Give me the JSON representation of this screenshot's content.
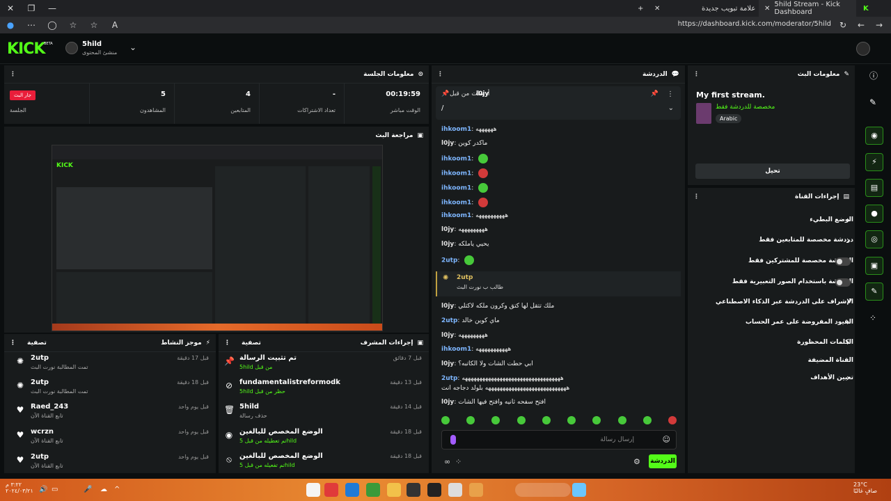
{
  "browser": {
    "tabs": [
      {
        "label": "علامة تبويب جديدة"
      },
      {
        "label": "5hild Stream - Kick Dashboard"
      }
    ],
    "url": "https://dashboard.kick.com/moderator/5hild"
  },
  "topnav": {
    "logo": "KICK",
    "beta": "BETA",
    "channel_name": "5hild",
    "channel_sub": "منشئ المحتوى"
  },
  "session": {
    "title": "معلومات الجلسة",
    "live_badge": "جار البث",
    "stats": [
      {
        "value": "00:19:59",
        "label": "الوقت مباشر"
      },
      {
        "value": "-",
        "label": "تعداد الاشتراكات"
      },
      {
        "value": "4",
        "label": "المتابعين"
      },
      {
        "value": "5",
        "label": "المشاهدون"
      },
      {
        "value": "",
        "label": "الجلسة"
      }
    ]
  },
  "preview": {
    "title": "مراجعة البث"
  },
  "activity": {
    "title": "موجز النشاط",
    "filter": "تصفية",
    "items": [
      {
        "name": "2utp",
        "sub": "تمت المطالبة نورت البث",
        "time": "قبل 17 دقيقة"
      },
      {
        "name": "2utp",
        "sub": "تمت المطالبة نورت البث",
        "time": "قبل 18 دقيقة"
      },
      {
        "name": "Raed_243",
        "sub": "تابع القناة الآن",
        "time": "قبل يوم واحد"
      },
      {
        "name": "wcrzn",
        "sub": "تابع القناة الآن",
        "time": "قبل يوم واحد"
      },
      {
        "name": "2utp",
        "sub": "تابع القناة الآن",
        "time": "قبل يوم واحد"
      }
    ]
  },
  "modactions": {
    "title": "إجراءات المشرف",
    "filter": "تصفية",
    "items": [
      {
        "name": "تم تثبيت الرسالة",
        "sub": "5hild من قبل",
        "time": "قبل 7 دقائق"
      },
      {
        "name": "fundamentalistreformodk",
        "sub": "5hild حظر من قبل",
        "time": "قبل 13 دقيقة"
      },
      {
        "name": "5hild",
        "sub": "حذف رسالة",
        "time": "قبل 14 دقيقة"
      },
      {
        "name": "الوضع المخصص للبالغين",
        "sub": "تم تعطيله من قبل 5hild",
        "time": "قبل 18 دقيقة"
      },
      {
        "name": "الوضع المخصص للبالغين",
        "sub": "تم تفعيله من قبل 5hild",
        "time": "قبل 18 دقيقة"
      }
    ]
  },
  "chat": {
    "title": "الدردشة",
    "pinned_by": "أرسلت من قبل",
    "pinned_user": "l0jy",
    "pinned_text": "/",
    "messages": [
      {
        "user": "ihkoom1",
        "text": "ههههههه"
      },
      {
        "user": "l0jy",
        "text": "ماكدر كوين"
      },
      {
        "user": "ihkoom1",
        "text": ""
      },
      {
        "user": "ihkoom1",
        "text": ""
      },
      {
        "user": "ihkoom1",
        "text": ""
      },
      {
        "user": "ihkoom1",
        "text": ""
      },
      {
        "user": "ihkoom1",
        "text": "ههههههههههه"
      },
      {
        "user": "l0jy",
        "text": "هههههههههه"
      },
      {
        "user": "l0jy",
        "text": "يحيي ياملكه"
      },
      {
        "user": "2utp",
        "text": ""
      },
      {
        "user": "l0jy",
        "text": "ملك تتقل لها كتق وكرون ملكه لاكتلي"
      },
      {
        "user": "2utp",
        "text": "ماي كوين خالد"
      },
      {
        "user": "l0jy",
        "text": "هههههههههه"
      },
      {
        "user": "ihkoom1",
        "text": "هههههههههههه"
      },
      {
        "user": "l0jy",
        "text": "ابي حطت الشات ولا الكاتبه؟"
      },
      {
        "user": "2utp",
        "text": "ههههههههههههههههههههههههههههههههههه"
      },
      {
        "user": "",
        "text": "ههههههههههههههههههههههههههههه بلولد دجاجه انت"
      },
      {
        "user": "l0jy",
        "text": "افتح سفحه ثانيه وافتح فيها الشات"
      }
    ],
    "highlight_user": "2utp",
    "highlight_text": "طالب ب نورت البث",
    "input_placeholder": "إرسال رسالة",
    "send_label": "الدردشة"
  },
  "info": {
    "title": "معلومات البث",
    "stream_title": "My first stream.",
    "category": "مخصصة للدردشة فقط",
    "language": "Arabic",
    "edit_label": "تحيل"
  },
  "channel_actions": {
    "title": "إجراءات القناة",
    "items": [
      {
        "label": "الوضع البطيء",
        "kind": "arrow"
      },
      {
        "label": "دردشة مخصصة للمتابعين فقط",
        "kind": "arrow"
      },
      {
        "label": "الدردشة مخصصة للمشتركين فقط",
        "kind": "toggle"
      },
      {
        "label": "الدردشة باستخدام الصور التعبيرية فقط",
        "kind": "toggle"
      },
      {
        "label": "الإشراف على الدردشة عبر الذكاء الاصطناعي",
        "kind": "external"
      },
      {
        "label": "القيود المفروضة على عمر الحساب",
        "kind": "arrow"
      },
      {
        "label": "الكلمات المحظورة",
        "kind": "arrow"
      },
      {
        "label": "القناة المضيفة",
        "kind": "none"
      },
      {
        "label": "تعيين الأهداف",
        "kind": "arrow"
      }
    ]
  },
  "taskbar": {
    "time": "٣:٢٢ م",
    "date": "٢٠٢٤/٠٣/٢١",
    "weather": "23°C",
    "weather_sub": "صافٍ غالبًا"
  }
}
